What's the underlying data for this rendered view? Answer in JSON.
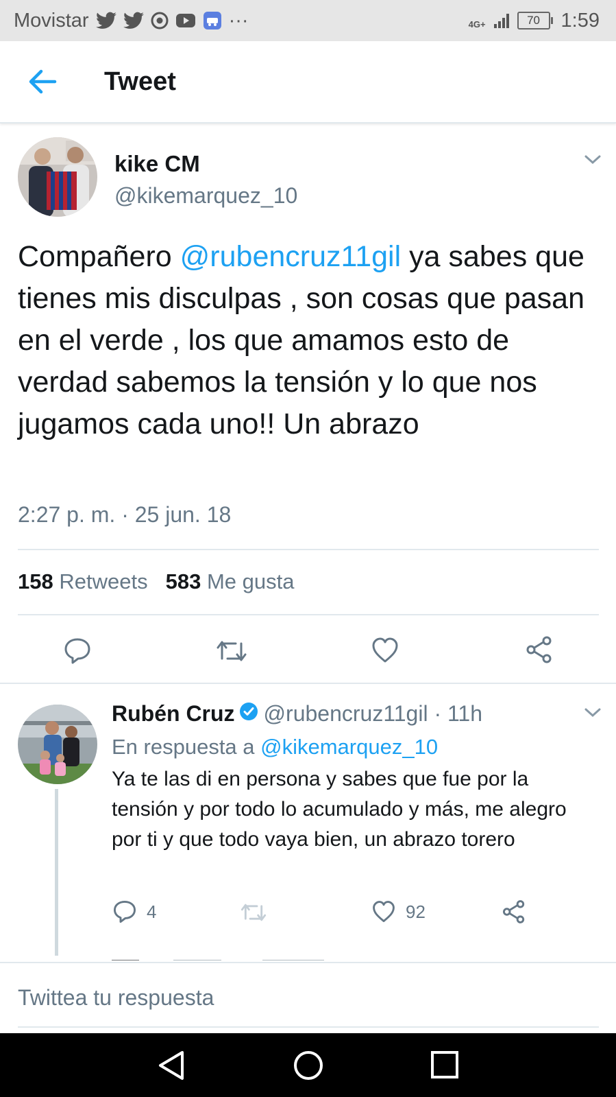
{
  "status_bar": {
    "carrier": "Movistar",
    "overflow": "···",
    "network": "4G+",
    "battery": "70",
    "time": "1:59"
  },
  "header": {
    "title": "Tweet"
  },
  "main_tweet": {
    "name": "kike CM",
    "handle": "@kikemarquez_10",
    "text_before": "Compañero ",
    "mention": "@rubencruz11gil",
    "text_after": " ya sabes que tienes mis disculpas , son cosas que pasan en el verde , los que amamos esto de verdad sabemos la tensión y lo que nos jugamos cada uno!! Un abrazo",
    "timestamp": "2:27 p. m. · 25 jun. 18",
    "retweets_count": "158",
    "retweets_label": "Retweets",
    "likes_count": "583",
    "likes_label": "Me gusta"
  },
  "reply": {
    "name": "Rubén Cruz",
    "handle_time": "@rubencruz11gil · 11h",
    "in_reply_prefix": "En respuesta a ",
    "in_reply_handle": "@kikemarquez_10",
    "text": "Ya te las di en persona y sabes que fue por la tensión y por todo lo acumulado y más, me alegro por ti y que todo vaya bien, un abrazo torero",
    "reply_count": "4",
    "like_count": "92"
  },
  "composer": {
    "placeholder": "Twittea tu respuesta"
  },
  "colors": {
    "accent": "#1da1f2",
    "secondary_text": "#657786",
    "divider": "#e1e8ed"
  }
}
